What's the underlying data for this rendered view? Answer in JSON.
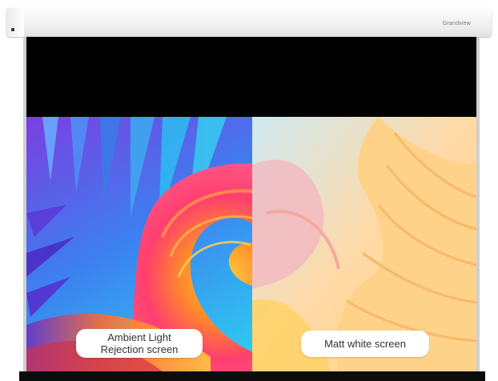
{
  "brand": "Grandview",
  "labels": {
    "left_line1": "Ambient Light",
    "left_line2": "Rejection screen",
    "right": "Matt white screen"
  }
}
